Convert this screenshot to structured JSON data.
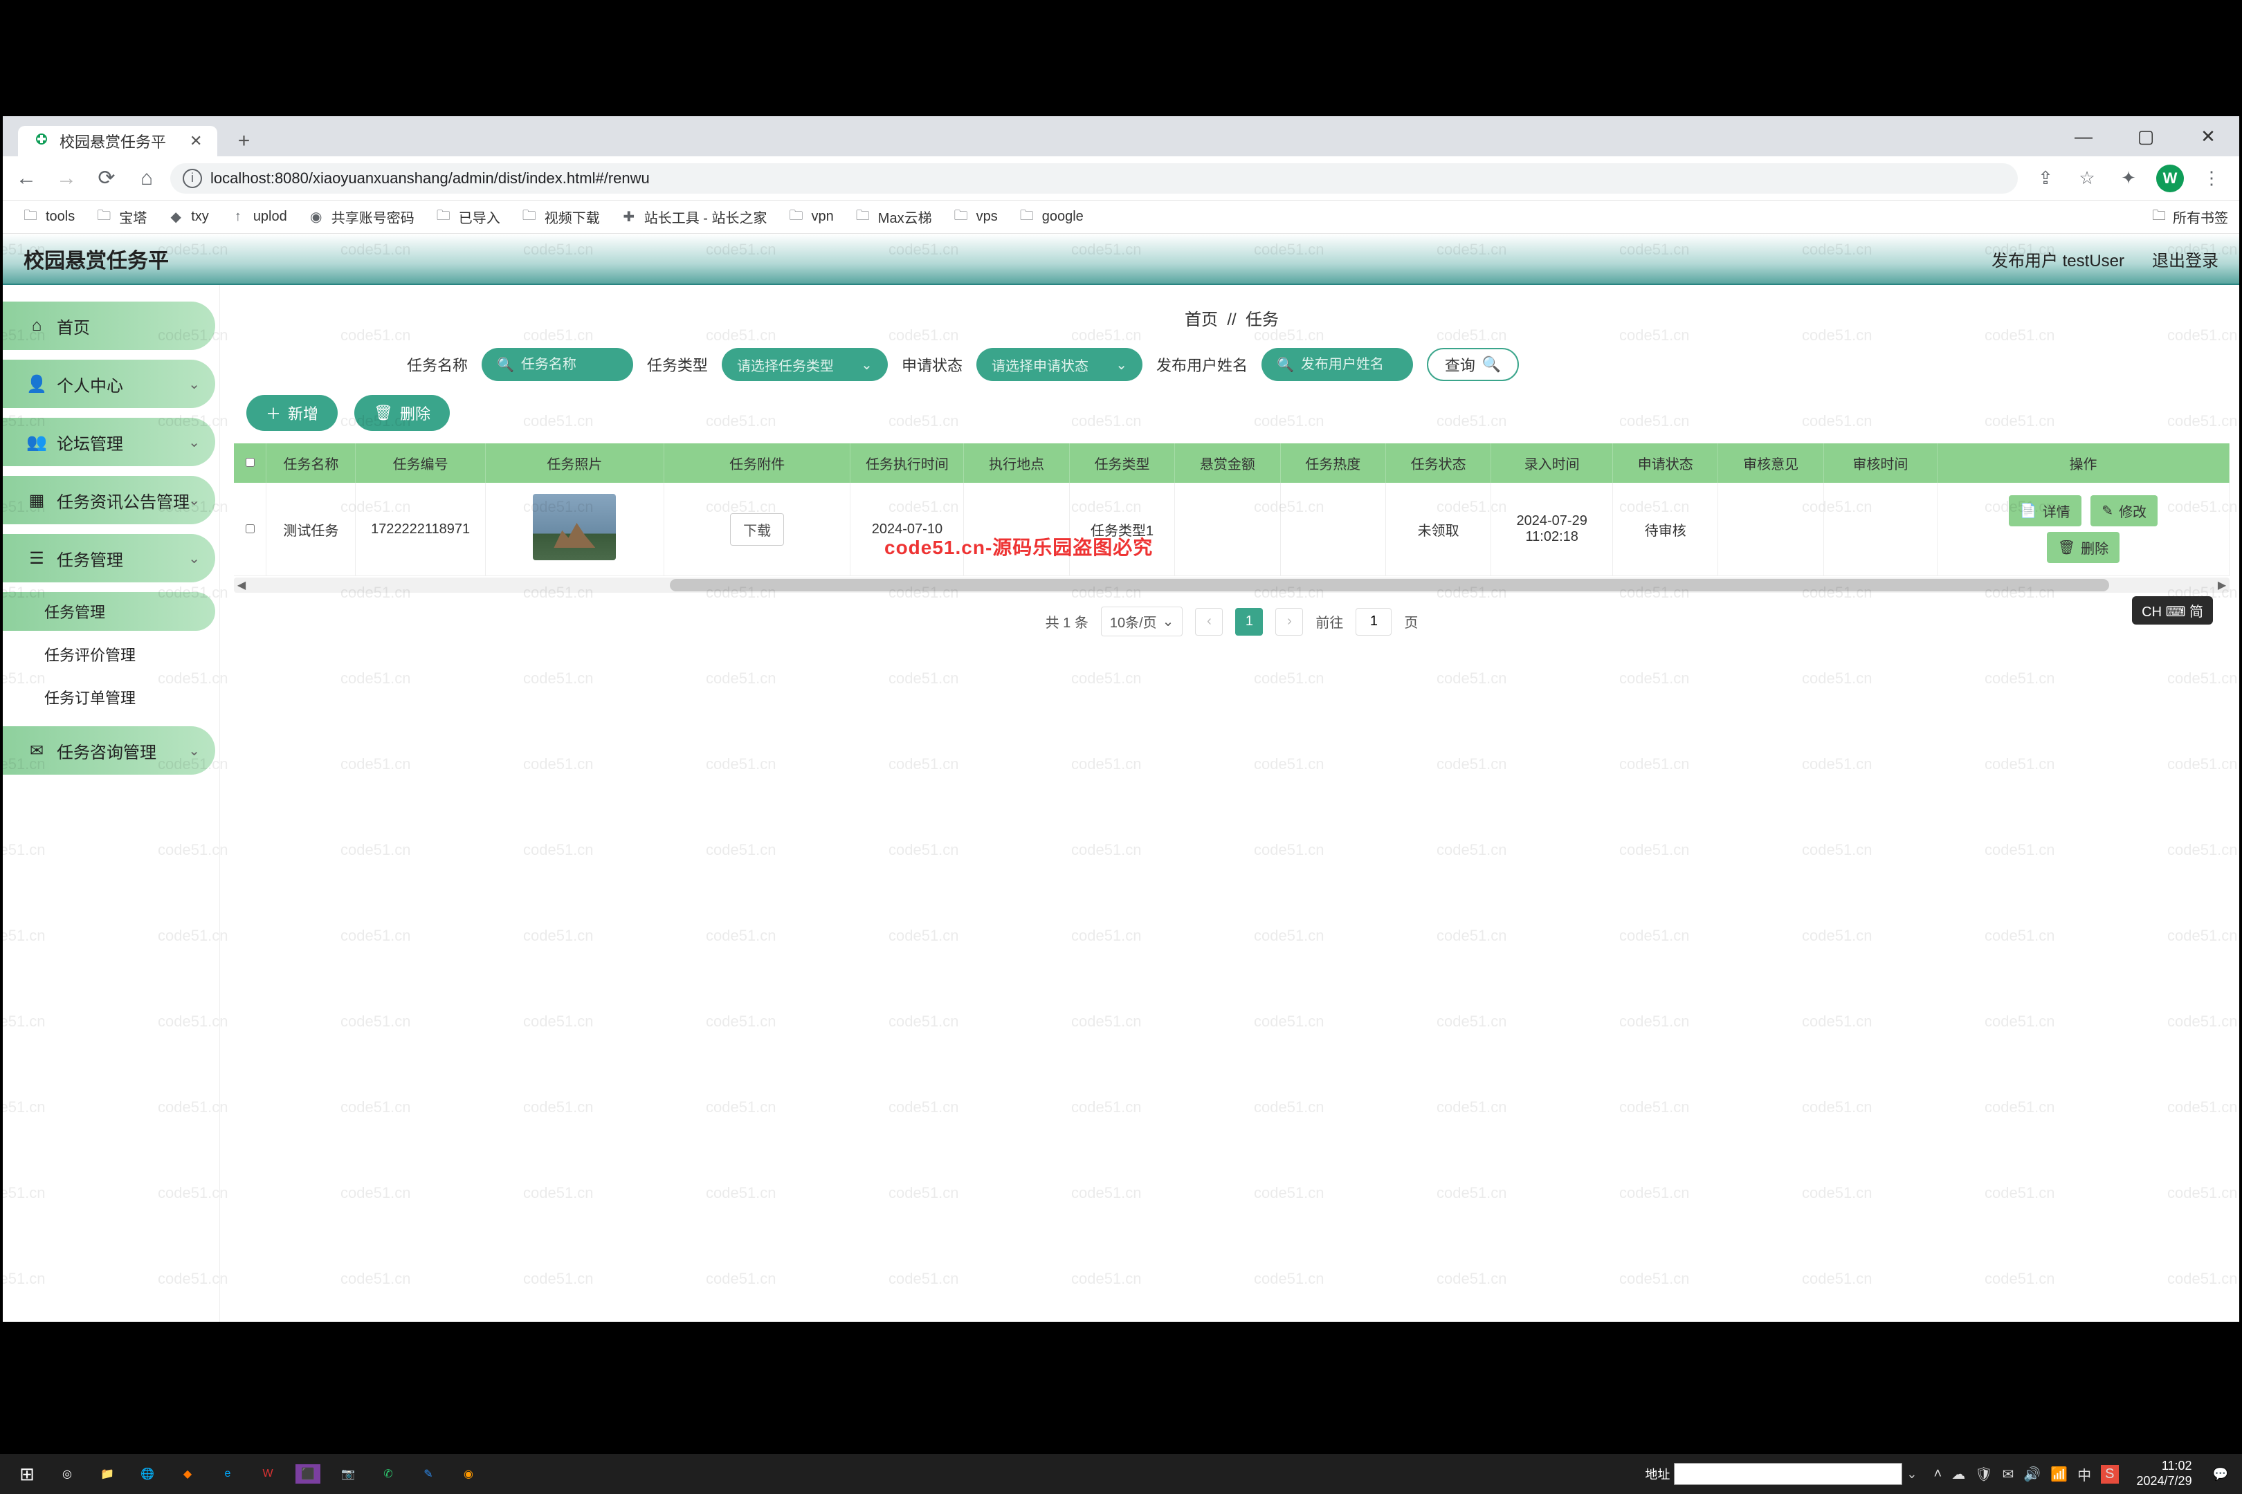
{
  "browser": {
    "tab_title": "校园悬赏任务平",
    "url": "localhost:8080/xiaoyuanxuanshang/admin/dist/index.html#/renwu",
    "avatar_letter": "W"
  },
  "bookmarks": [
    "tools",
    "宝塔",
    "txy",
    "uplod",
    "共享账号密码",
    "已导入",
    "视频下载",
    "站长工具 - 站长之家",
    "vpn",
    "Max云梯",
    "vps",
    "google"
  ],
  "bookmarks_right": "所有书签",
  "header": {
    "title": "校园悬赏任务平",
    "user_label": "发布用户",
    "user_value": "testUser",
    "logout": "退出登录"
  },
  "sidebar": [
    {
      "icon": "home",
      "label": "首页",
      "expand": false
    },
    {
      "icon": "user",
      "label": "个人中心",
      "expand": true
    },
    {
      "icon": "users",
      "label": "论坛管理",
      "expand": true
    },
    {
      "icon": "grid",
      "label": "任务资讯公告管理",
      "expand": true
    },
    {
      "icon": "list",
      "label": "任务管理",
      "expand": true,
      "open": true,
      "children": [
        {
          "label": "任务管理",
          "active": true
        },
        {
          "label": "任务评价管理",
          "active": false
        },
        {
          "label": "任务订单管理",
          "active": false
        }
      ]
    },
    {
      "icon": "chat",
      "label": "任务咨询管理",
      "expand": true
    }
  ],
  "breadcrumb": {
    "a": "首页",
    "sep": "//",
    "b": "任务"
  },
  "filters": {
    "name_label": "任务名称",
    "name_ph": "任务名称",
    "type_label": "任务类型",
    "type_ph": "请选择任务类型",
    "status_label": "申请状态",
    "status_ph": "请选择申请状态",
    "user_label": "发布用户姓名",
    "user_ph": "发布用户姓名",
    "search_btn": "查询"
  },
  "actions": {
    "add": "新增",
    "del": "删除"
  },
  "columns": [
    "任务名称",
    "任务编号",
    "任务照片",
    "任务附件",
    "任务执行时间",
    "执行地点",
    "任务类型",
    "悬赏金额",
    "任务热度",
    "任务状态",
    "录入时间",
    "申请状态",
    "审核意见",
    "审核时间",
    "操作"
  ],
  "row": {
    "name": "测试任务",
    "code": "1722222118971",
    "attach_btn": "下载",
    "exec_time": "2024-07-10",
    "exec_place": "",
    "type": "任务类型1",
    "amount": "",
    "heat": "",
    "task_status": "未领取",
    "entry_time": "2024-07-29 11:02:18",
    "apply_status": "待审核",
    "review": "",
    "review_time": "",
    "op_detail": "详情",
    "op_edit": "修改",
    "op_del": "删除"
  },
  "pager": {
    "total": "共 1 条",
    "size": "10条/页",
    "current": "1",
    "goto_label": "前往",
    "goto_val": "1",
    "page_suffix": "页"
  },
  "ime_badge": "CH ⌨ 简",
  "taskbar": {
    "addr_label": "地址",
    "time": "11:02",
    "date": "2024/7/29"
  },
  "watermark": "code51.cn",
  "red_wm": "code51.cn-源码乐园盗图必究"
}
